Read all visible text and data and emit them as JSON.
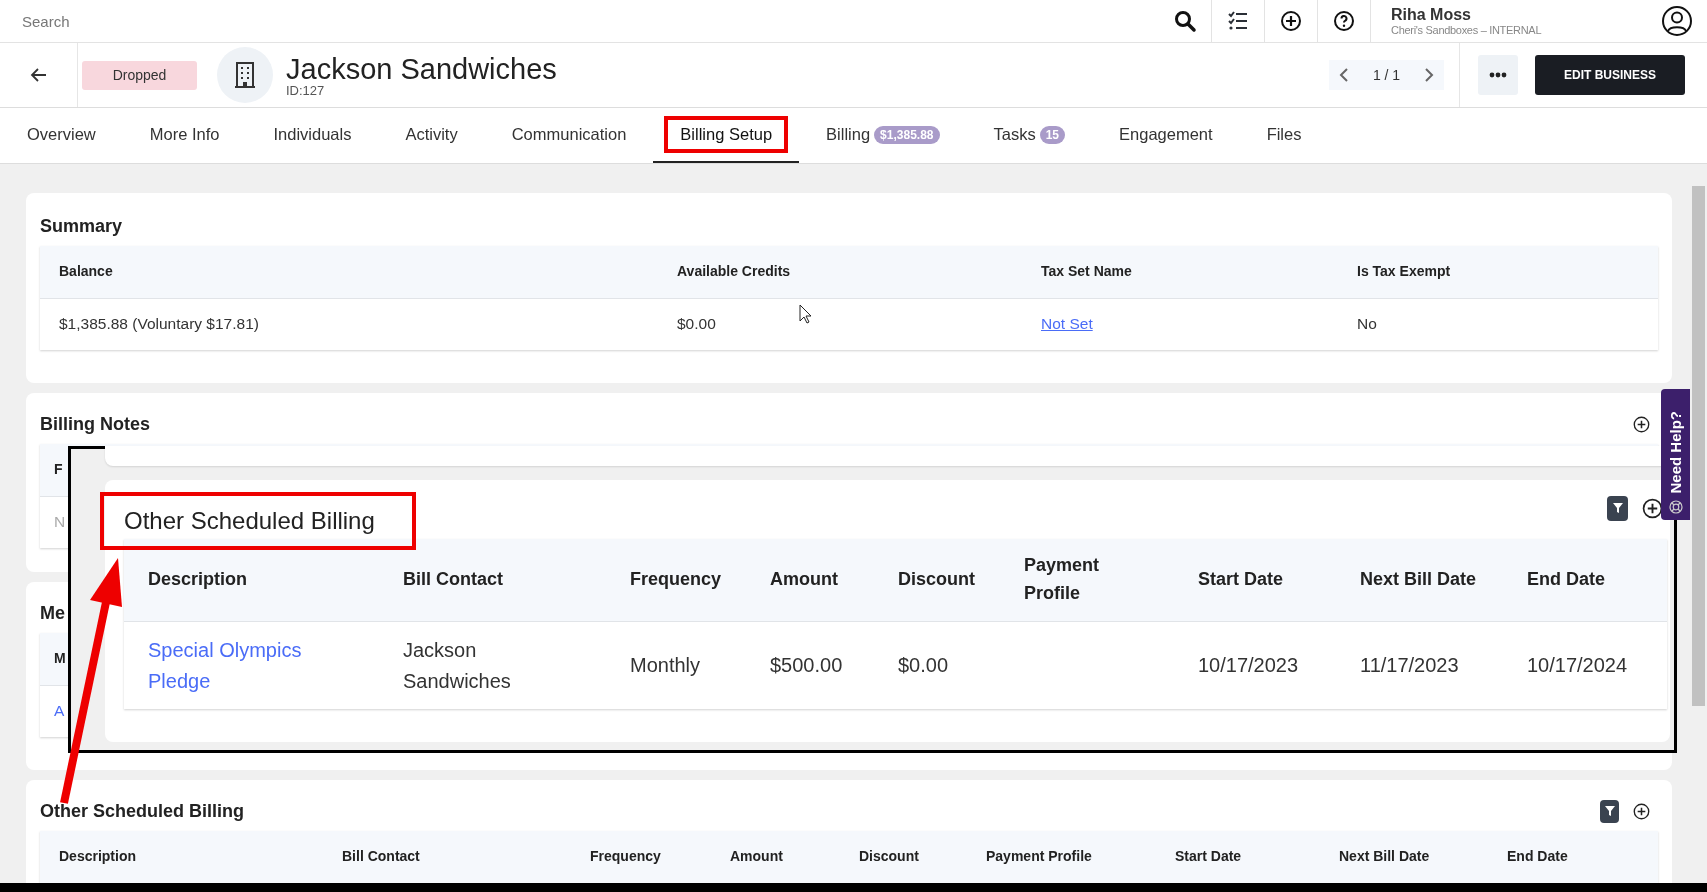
{
  "top_bar": {
    "search": {
      "placeholder": "Search"
    },
    "user": {
      "name": "Riha Moss",
      "org": "Cheri's Sandboxes – INTERNAL"
    }
  },
  "header": {
    "status": "Dropped",
    "title": "Jackson Sandwiches",
    "id": "ID:127",
    "pager": "1 / 1",
    "edit_button": "EDIT BUSINESS"
  },
  "tabs": [
    {
      "label": "Overview",
      "selected": false,
      "highlighted": false
    },
    {
      "label": "More Info",
      "selected": false,
      "highlighted": false
    },
    {
      "label": "Individuals",
      "selected": false,
      "highlighted": false
    },
    {
      "label": "Activity",
      "selected": false,
      "highlighted": false
    },
    {
      "label": "Communication",
      "selected": false,
      "highlighted": false
    },
    {
      "label": "Billing Setup",
      "selected": true,
      "highlighted": true
    },
    {
      "label": "Billing",
      "badge": "$1,385.88",
      "selected": false,
      "highlighted": false
    },
    {
      "label": "Tasks",
      "badge": "15",
      "selected": false,
      "highlighted": false
    },
    {
      "label": "Engagement",
      "selected": false,
      "highlighted": false
    },
    {
      "label": "Files",
      "selected": false,
      "highlighted": false
    }
  ],
  "summary": {
    "title": "Summary",
    "columns": [
      "Balance",
      "Available Credits",
      "Tax Set Name",
      "Is Tax Exempt"
    ],
    "rows": [
      [
        {
          "text": "$1,385.88 (Voluntary $17.81)",
          "kind": "text"
        },
        {
          "text": "$0.00",
          "kind": "text"
        },
        {
          "text": "Not Set",
          "kind": "link"
        },
        {
          "text": "No",
          "kind": "text"
        }
      ]
    ]
  },
  "billing_notes": {
    "title": "Billing Notes",
    "columns": [
      "F"
    ],
    "rows": [
      [
        {
          "text": "N",
          "kind": "muted"
        }
      ]
    ]
  },
  "section_3": {
    "title": "Me",
    "columns": [
      "M"
    ],
    "rows": [
      [
        {
          "text": "A",
          "kind": "link"
        }
      ]
    ]
  },
  "other_scheduled_billing": {
    "title": "Other Scheduled Billing",
    "columns": [
      "Description",
      "Bill Contact",
      "Frequency",
      "Amount",
      "Discount",
      "Payment Profile",
      "Start Date",
      "Next Bill Date",
      "End Date"
    ]
  },
  "callout": {
    "title": "Other Scheduled Billing",
    "columns": [
      "Description",
      "Bill Contact",
      "Frequency",
      "Amount",
      "Discount",
      "Payment Profile",
      "Start Date",
      "Next Bill Date",
      "End Date"
    ],
    "rows": [
      [
        {
          "text": "Special Olympics Pledge",
          "kind": "link"
        },
        {
          "text": "Jackson Sandwiches",
          "kind": "text"
        },
        {
          "text": "Monthly",
          "kind": "text"
        },
        {
          "text": "$500.00",
          "kind": "text"
        },
        {
          "text": "$0.00",
          "kind": "text"
        },
        {
          "kind": "empty"
        },
        {
          "text": "10/17/2023",
          "kind": "text"
        },
        {
          "text": "11/17/2023",
          "kind": "text"
        },
        {
          "text": "10/17/2024",
          "kind": "text"
        }
      ]
    ]
  },
  "need_help": "Need Help?"
}
